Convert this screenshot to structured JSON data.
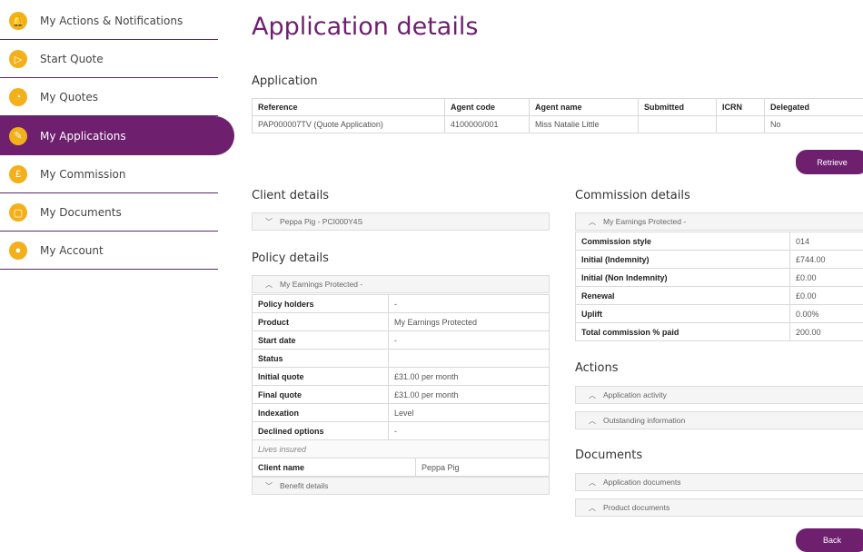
{
  "sidebar": {
    "items": [
      {
        "label": "My Actions & Notifications",
        "icon": "bell-icon",
        "glyph": "🔔"
      },
      {
        "label": "Start Quote",
        "icon": "play-icon",
        "glyph": "▷"
      },
      {
        "label": "My Quotes",
        "icon": "quote-icon",
        "glyph": "◔"
      },
      {
        "label": "My Applications",
        "icon": "application-icon",
        "glyph": "✎"
      },
      {
        "label": "My Commission",
        "icon": "commission-icon",
        "glyph": "£"
      },
      {
        "label": "My Documents",
        "icon": "documents-icon",
        "glyph": "▢"
      },
      {
        "label": "My Account",
        "icon": "account-icon",
        "glyph": "●"
      }
    ]
  },
  "page_title": "Application details",
  "application": {
    "title": "Application",
    "headers": [
      "Reference",
      "Agent code",
      "Agent name",
      "Submitted",
      "ICRN",
      "Delegated"
    ],
    "row": [
      "PAP000007TV (Quote Application)",
      "4100000/001",
      "Miss Natalie Little",
      "",
      "",
      "No"
    ]
  },
  "retrieve_label": "Retrieve",
  "client": {
    "title": "Client details",
    "panel": "Peppa Pig - PCI000Y4S"
  },
  "policy": {
    "title": "Policy details",
    "panel": "My Earnings Protected -",
    "rows": [
      [
        "Policy holders",
        "-"
      ],
      [
        "Product",
        "My Earnings Protected"
      ],
      [
        "Start date",
        "-"
      ],
      [
        "Status",
        ""
      ],
      [
        "Initial quote",
        "£31.00 per month"
      ],
      [
        "Final quote",
        "£31.00 per month"
      ],
      [
        "Indexation",
        "Level"
      ],
      [
        "Declined options",
        "-"
      ]
    ],
    "lives_insured": "Lives insured",
    "client_name_label": "Client name",
    "client_name_value": "Peppa Pig",
    "benefit_details": "Benefit details"
  },
  "commission": {
    "title": "Commission details",
    "panel": "My Earnings Protected -",
    "rows": [
      [
        "Commission style",
        "014"
      ],
      [
        "Initial (Indemnity)",
        "£744.00"
      ],
      [
        "Initial (Non Indemnity)",
        "£0.00"
      ],
      [
        "Renewal",
        "£0.00"
      ],
      [
        "Uplift",
        "0.00%"
      ],
      [
        "Total commission % paid",
        "200.00"
      ]
    ]
  },
  "actions": {
    "title": "Actions",
    "panels": [
      "Application activity",
      "Outstanding information"
    ]
  },
  "documents": {
    "title": "Documents",
    "panels": [
      "Application documents",
      "Product documents"
    ]
  },
  "back_label": "Back",
  "colors": {
    "brand": "#6e1f6e",
    "icon": "#f3b01b"
  }
}
